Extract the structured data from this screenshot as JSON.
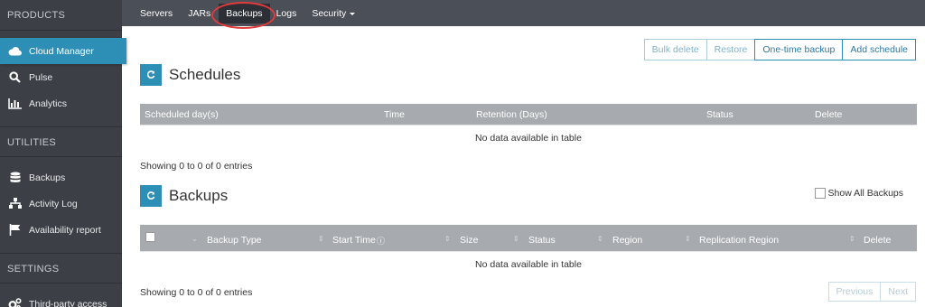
{
  "sidebar": {
    "sections": [
      {
        "title": "PRODUCTS",
        "items": [
          {
            "label": "Cloud Manager",
            "icon": "cloud-icon"
          },
          {
            "label": "Pulse",
            "icon": "search-icon"
          },
          {
            "label": "Analytics",
            "icon": "bar-chart-icon"
          }
        ]
      },
      {
        "title": "UTILITIES",
        "items": [
          {
            "label": "Backups",
            "icon": "database-icon"
          },
          {
            "label": "Activity Log",
            "icon": "sitemap-icon"
          },
          {
            "label": "Availability report",
            "icon": "flag-icon"
          }
        ]
      },
      {
        "title": "SETTINGS",
        "items": [
          {
            "label": "Third-party access",
            "icon": "gears-icon"
          }
        ]
      }
    ]
  },
  "topnav": {
    "tabs": [
      "Servers",
      "JARs",
      "Backups",
      "Logs",
      "Security"
    ],
    "active": "Backups"
  },
  "actions": {
    "bulk_delete": "Bulk delete",
    "restore": "Restore",
    "one_time_backup": "One-time backup",
    "add_schedule": "Add schedule"
  },
  "schedules": {
    "title": "Schedules",
    "columns": [
      "Scheduled day(s)",
      "Time",
      "Retention (Days)",
      "Status",
      "Delete"
    ],
    "empty": "No data available in table",
    "showing": "Showing 0 to 0 of 0 entries"
  },
  "backups": {
    "title": "Backups",
    "show_all_label": "Show All Backups",
    "columns": [
      "Backup Type",
      "Start Time",
      "Size",
      "Status",
      "Region",
      "Replication Region",
      "Delete"
    ],
    "empty": "No data available in table",
    "showing": "Showing 0 to 0 of 0 entries"
  },
  "pagination": {
    "previous": "Previous",
    "next": "Next"
  },
  "colors": {
    "accent": "#2e8fb6",
    "sidebar": "#3c3f46",
    "topnav": "#4b4f57",
    "table_header": "#a7aaaf",
    "highlight": "#e23b3b"
  }
}
